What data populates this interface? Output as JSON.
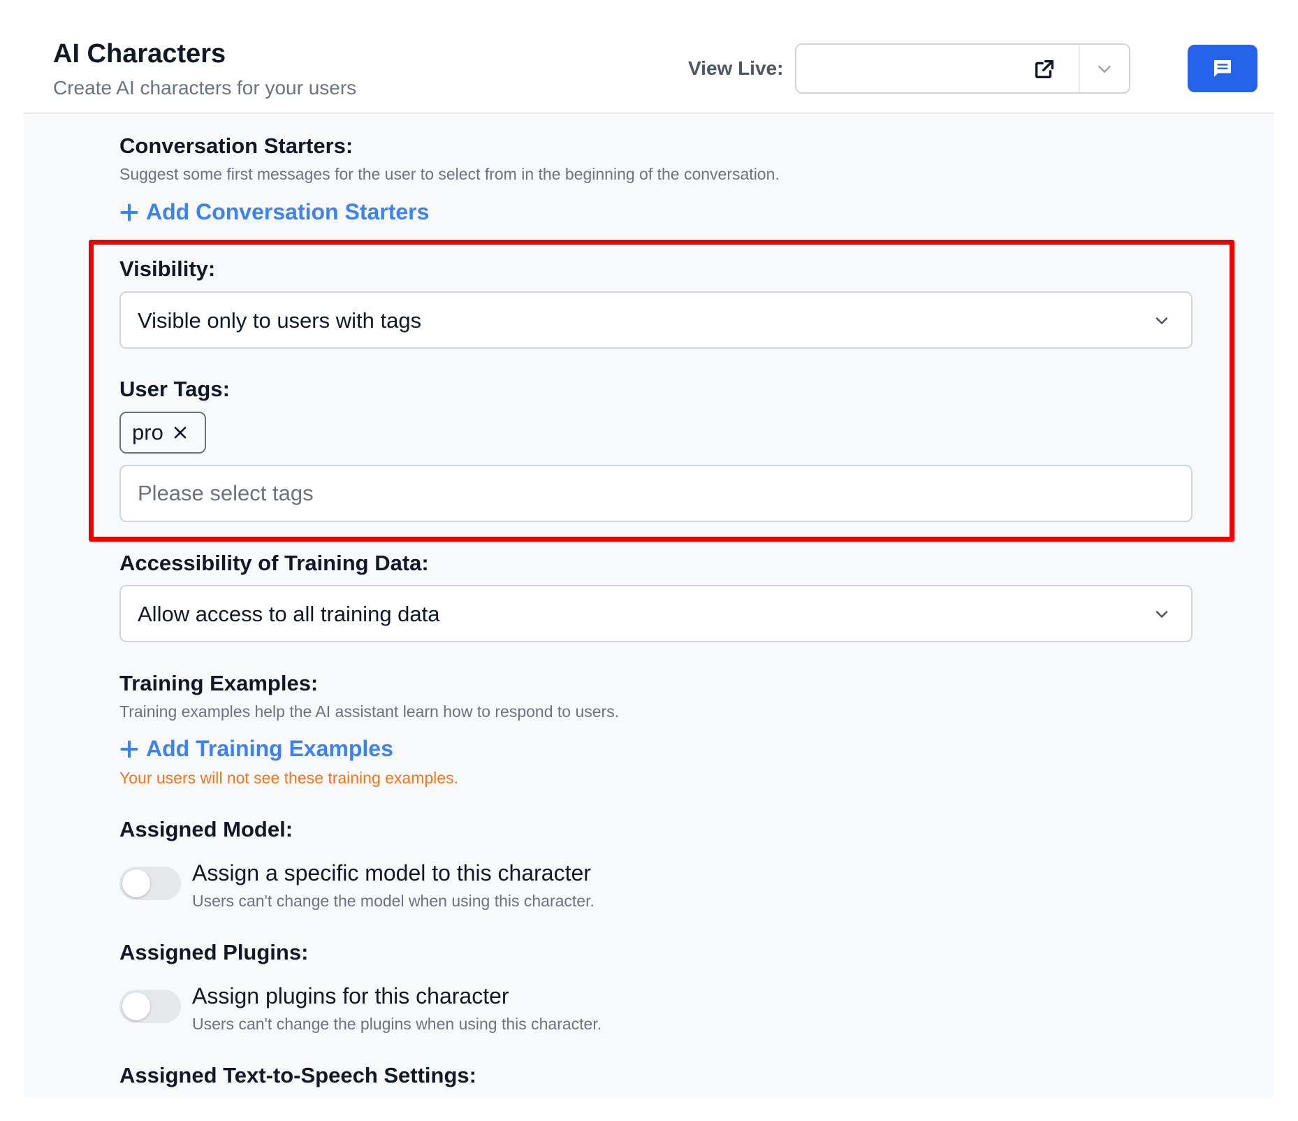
{
  "header": {
    "title": "AI Characters",
    "subtitle": "Create AI characters for your users",
    "view_live_label": "View Live:",
    "view_live_value": ""
  },
  "conversation_starters": {
    "label": "Conversation Starters:",
    "description": "Suggest some first messages for the user to select from in the beginning of the conversation.",
    "add_label": "Add Conversation Starters"
  },
  "visibility": {
    "label": "Visibility:",
    "value": "Visible only to users with tags"
  },
  "user_tags": {
    "label": "User Tags:",
    "tags": [
      "pro"
    ],
    "placeholder": "Please select tags"
  },
  "training_access": {
    "label": "Accessibility of Training Data:",
    "value": "Allow access to all training data"
  },
  "training_examples": {
    "label": "Training Examples:",
    "description": "Training examples help the AI assistant learn how to respond to users.",
    "add_label": "Add Training Examples",
    "warning": "Your users will not see these training examples."
  },
  "assigned_model": {
    "label": "Assigned Model:",
    "toggle_title": "Assign a specific model to this character",
    "toggle_desc": "Users can't change the model when using this character.",
    "enabled": false
  },
  "assigned_plugins": {
    "label": "Assigned Plugins:",
    "toggle_title": "Assign plugins for this character",
    "toggle_desc": "Users can't change the plugins when using this character.",
    "enabled": false
  },
  "tts": {
    "label": "Assigned Text-to-Speech Settings:"
  },
  "colors": {
    "accent": "#2563eb",
    "link": "#3b82f6",
    "warning": "#f97316",
    "highlight": "#ee0000"
  },
  "icons": {
    "open_external": "external-link-icon",
    "chevron": "chevron-down-icon",
    "chat": "chat-icon",
    "plus": "plus-icon",
    "remove": "close-icon"
  }
}
